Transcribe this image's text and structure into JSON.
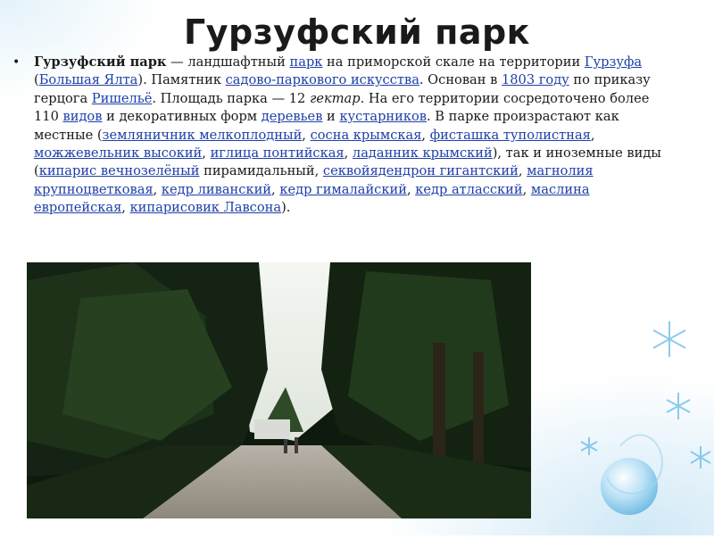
{
  "slide": {
    "title": "Гурзуфский парк"
  },
  "paragraph": {
    "bullet": "•",
    "parts": [
      {
        "t": "Гурзуфский парк",
        "s": "bold"
      },
      {
        "t": " — ландшафтный "
      },
      {
        "t": "парк",
        "s": "link"
      },
      {
        "t": " на приморской скале на территории "
      },
      {
        "t": "Гурзуфа",
        "s": "link"
      },
      {
        "t": " ("
      },
      {
        "t": "Большая Ялта",
        "s": "link"
      },
      {
        "t": "). Памятник "
      },
      {
        "t": "садово-паркового искусства",
        "s": "link"
      },
      {
        "t": ". Основан в "
      },
      {
        "t": "1803 году",
        "s": "link"
      },
      {
        "t": " по приказу герцога "
      },
      {
        "t": "Ришельё",
        "s": "link"
      },
      {
        "t": ". Площадь парка — 12 "
      },
      {
        "t": "гектар",
        "s": "italic"
      },
      {
        "t": ". На его территории сосредоточено более 110 "
      },
      {
        "t": "видов",
        "s": "link"
      },
      {
        "t": " и декоративных форм "
      },
      {
        "t": "деревьев",
        "s": "link"
      },
      {
        "t": " и "
      },
      {
        "t": "кустарников",
        "s": "link"
      },
      {
        "t": ". В парке произрастают как местные ("
      },
      {
        "t": "земляничник мелкоплодный",
        "s": "link"
      },
      {
        "t": ", "
      },
      {
        "t": "сосна крымская",
        "s": "link"
      },
      {
        "t": ", "
      },
      {
        "t": "фисташка туполистная",
        "s": "link"
      },
      {
        "t": ", "
      },
      {
        "t": "можжевельник высокий",
        "s": "link"
      },
      {
        "t": ", "
      },
      {
        "t": "иглица понтийская",
        "s": "link"
      },
      {
        "t": ", "
      },
      {
        "t": "ладанник крымский",
        "s": "link"
      },
      {
        "t": "), так и иноземные виды ("
      },
      {
        "t": "кипарис вечнозелёный",
        "s": "link"
      },
      {
        "t": " пирамидальный, "
      },
      {
        "t": "секвойядендрон гигантский",
        "s": "link"
      },
      {
        "t": ", "
      },
      {
        "t": "магнолия крупноцветковая",
        "s": "link"
      },
      {
        "t": ", "
      },
      {
        "t": "кедр ливанский",
        "s": "link"
      },
      {
        "t": ", "
      },
      {
        "t": "кедр гималайский",
        "s": "link"
      },
      {
        "t": ", "
      },
      {
        "t": "кедр атласский",
        "s": "link"
      },
      {
        "t": ", "
      },
      {
        "t": "маслина европейская",
        "s": "link"
      },
      {
        "t": ", "
      },
      {
        "t": "кипарисовик Лавсона",
        "s": "link"
      },
      {
        "t": ")."
      }
    ]
  },
  "colors": {
    "link": "#1e3fa8",
    "text": "#1a1a1a",
    "accent": "#7cc3e6"
  }
}
